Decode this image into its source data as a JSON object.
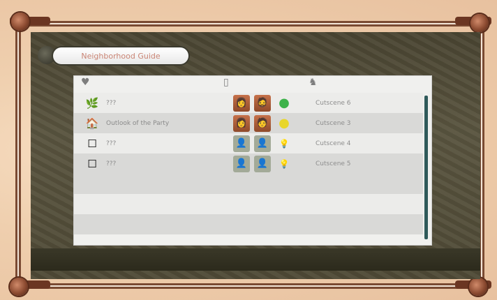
{
  "screen": {
    "title": "Neighborhood Guide",
    "columns": {
      "guide_icon": "heart-icon",
      "party_icon": "document-icon",
      "progress_icon": "character-icon"
    }
  },
  "colors": {
    "frame": "#7a4a32",
    "panel": "#f0f0ee",
    "stripe": "#d9d9d7",
    "status_green": "#3db24a",
    "status_yellow": "#e8d62a",
    "scrollbar": "#2f5a5a"
  },
  "rows": [
    {
      "name": "???",
      "emblem": "green-leaf-icon",
      "emblem_glyph": "🌿",
      "portraits": [
        "👩",
        "🧔"
      ],
      "portrait_state": "active",
      "status": "green-circle-icon",
      "status_glyph": "●",
      "progress": "Cutscene 6"
    },
    {
      "name": "Outlook of the Party",
      "emblem": "house-icon",
      "emblem_glyph": "🏠",
      "portraits": [
        "👩",
        "🧑"
      ],
      "portrait_state": "active",
      "status": "yellow-circle-icon",
      "status_glyph": "●",
      "progress": "Cutscene 3"
    },
    {
      "name": "???",
      "emblem": "empty-square-icon",
      "emblem_glyph": "☐",
      "portraits": [
        "👤",
        "👤"
      ],
      "portrait_state": "inactive",
      "status": "lightbulb-icon",
      "status_glyph": "💡",
      "progress": "Cutscene 4"
    },
    {
      "name": "???",
      "emblem": "empty-square-icon",
      "emblem_glyph": "☐",
      "portraits": [
        "👤",
        "👤"
      ],
      "portrait_state": "inactive",
      "status": "lightbulb-icon",
      "status_glyph": "💡",
      "progress": "Cutscene 5"
    }
  ]
}
